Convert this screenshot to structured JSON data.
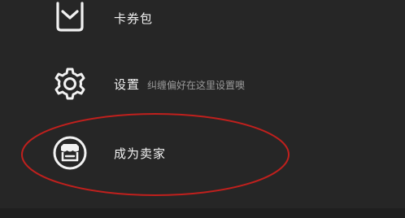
{
  "menu": {
    "wallet": {
      "label": "卡券包",
      "icon": "wallet-icon"
    },
    "settings": {
      "label": "设置",
      "hint": "纠缠偏好在这里设置噢",
      "icon": "gear-icon"
    },
    "seller": {
      "label": "成为卖家",
      "icon": "storefront-icon"
    }
  },
  "colors": {
    "background": "#262626",
    "text": "#f2f2f2",
    "hint": "#9a9a9a",
    "annotation": "#c0201d"
  }
}
